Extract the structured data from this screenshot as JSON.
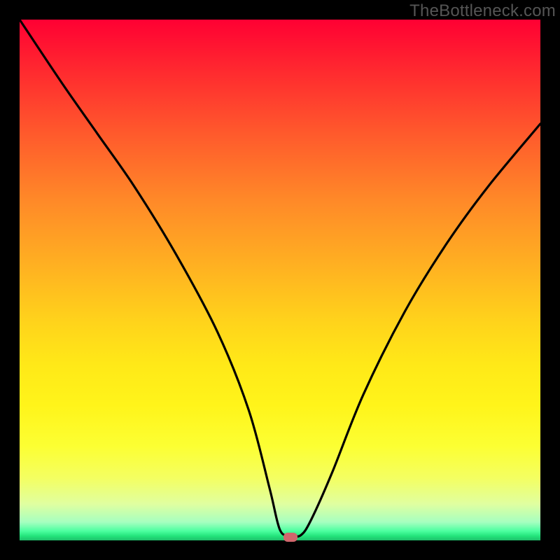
{
  "attribution": "TheBottleneck.com",
  "chart_data": {
    "type": "line",
    "title": "",
    "xlabel": "",
    "ylabel": "",
    "xlim": [
      0,
      100
    ],
    "ylim": [
      0,
      100
    ],
    "grid": false,
    "legend": false,
    "series": [
      {
        "name": "bottleneck-curve",
        "x": [
          0,
          8,
          15,
          22,
          30,
          38,
          44,
          48,
          50,
          52,
          54,
          56,
          60,
          66,
          74,
          82,
          90,
          100
        ],
        "y": [
          100,
          88,
          78,
          68,
          55,
          40,
          25,
          10,
          2,
          1,
          1,
          4,
          13,
          28,
          44,
          57,
          68,
          80
        ]
      }
    ],
    "marker": {
      "x": 52,
      "y": 0.7,
      "color": "#d1666c"
    },
    "background_gradient": {
      "top": "#ff0033",
      "mid": "#ffe818",
      "bottom": "#1fbf6a"
    }
  }
}
